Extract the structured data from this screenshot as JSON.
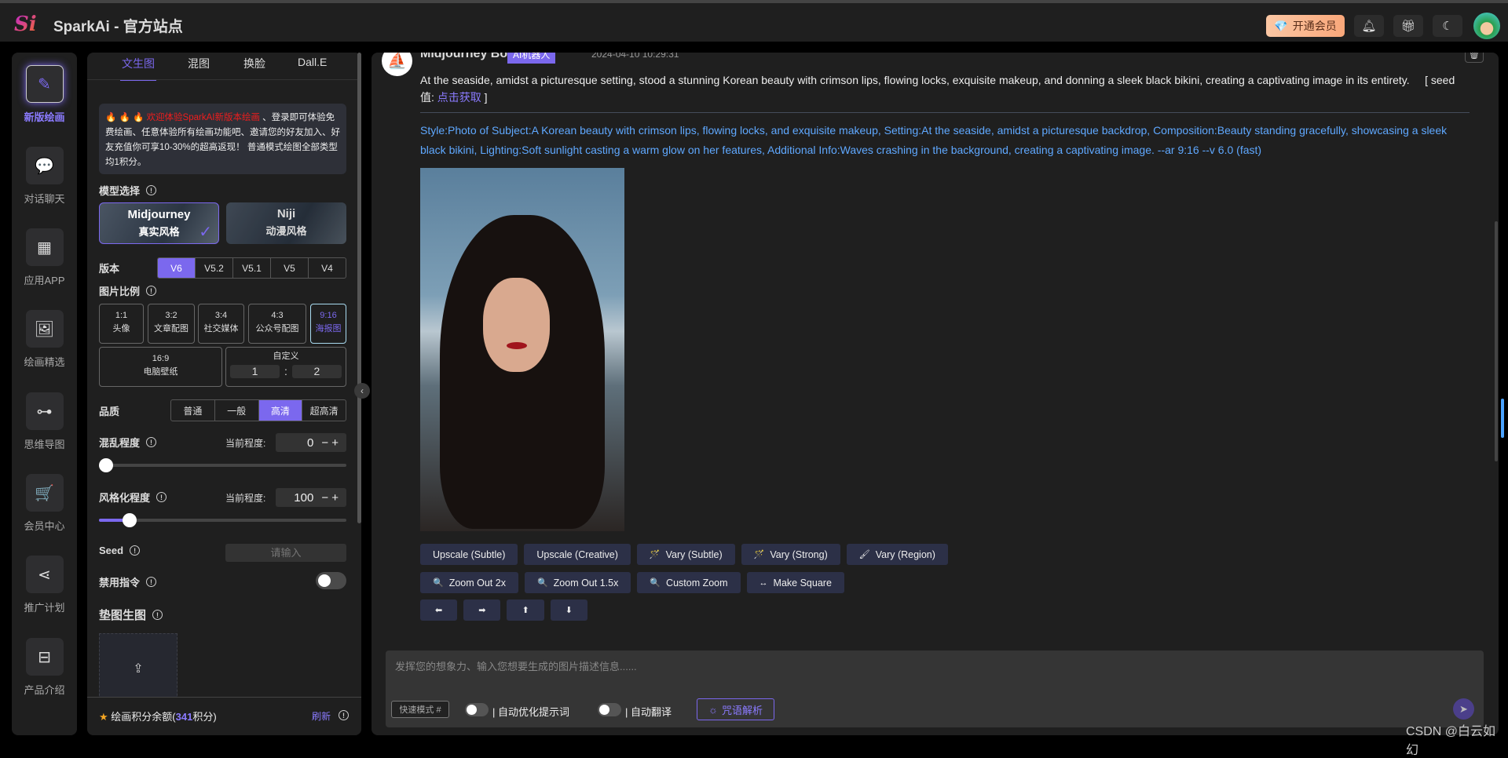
{
  "header": {
    "logo_text": "Si",
    "title": "SparkAi - 官方站点",
    "vip_label": "开通会员",
    "icons": [
      "bell-icon",
      "gift-icon",
      "moon-icon"
    ]
  },
  "nav": {
    "items": [
      {
        "label": "新版绘画",
        "icon": "✎",
        "active": true
      },
      {
        "label": "对话聊天",
        "icon": "💬"
      },
      {
        "label": "应用APP",
        "icon": "▦"
      },
      {
        "label": "绘画精选",
        "icon": "🖼"
      },
      {
        "label": "思维导图",
        "icon": "⊶"
      },
      {
        "label": "会员中心",
        "icon": "🛒"
      },
      {
        "label": "推广计划",
        "icon": "⋖"
      },
      {
        "label": "产品介绍",
        "icon": "⊟"
      }
    ]
  },
  "panel": {
    "tabs": [
      "文生图",
      "混图",
      "换脸",
      "Dall.E"
    ],
    "notice": {
      "fire": "🔥 🔥 🔥",
      "highlight": "欢迎体验SparkAI新版本绘画",
      "rest": " 、登录即可体验免费绘画、任意体验所有绘画功能吧、邀请您的好友加入、好友充值你可享10-30%的超高返现！ 普通模式绘图全部类型均1积分。"
    },
    "model_label": "模型选择",
    "models": [
      {
        "name": "Midjourney",
        "style": "真实风格"
      },
      {
        "name": "Niji",
        "style": "动漫风格"
      }
    ],
    "version_label": "版本",
    "versions": [
      "V6",
      "V5.2",
      "V5.1",
      "V5",
      "V4"
    ],
    "selected_version": "V6",
    "ratio_label": "图片比例",
    "ratios": [
      {
        "r": "1:1",
        "d": "头像"
      },
      {
        "r": "3:2",
        "d": "文章配图"
      },
      {
        "r": "3:4",
        "d": "社交媒体"
      },
      {
        "r": "4:3",
        "d": "公众号配图"
      },
      {
        "r": "9:16",
        "d": "海报图"
      }
    ],
    "ratio_wide": {
      "r": "16:9",
      "d": "电脑壁纸"
    },
    "custom": {
      "label": "自定义",
      "w": "1",
      "sep": ":",
      "h": "2"
    },
    "quality_label": "品质",
    "qualities": [
      "普通",
      "一般",
      "高清",
      "超高清"
    ],
    "selected_quality": "高清",
    "chaos": {
      "label": "混乱程度",
      "current_label": "当前程度:",
      "value": "0",
      "percent": 0
    },
    "stylize": {
      "label": "风格化程度",
      "current_label": "当前程度:",
      "value": "100",
      "percent": 10
    },
    "seed": {
      "label": "Seed",
      "placeholder": "请输入"
    },
    "no_cmd": {
      "label": "禁用指令",
      "on": false
    },
    "ref_image_label": "垫图生图",
    "footer": {
      "prefix": "绘画积分余额(",
      "points": "341",
      "suffix": "积分)",
      "refresh": "刷新"
    }
  },
  "message": {
    "bot_name": "Midjourney Bot",
    "badge": "AI机器人",
    "timestamp": "2024-04-10 10:29:31",
    "prompt": "At the seaside, amidst a picturesque setting, stood a stunning Korean beauty with crimson lips, flowing locks, exquisite makeup, and donning a sleek black bikini, creating a captivating image in its entirety.",
    "seed_prefix": "[ seed值: ",
    "seed_link": "点击获取",
    "seed_suffix": " ]",
    "description": "Style:Photo of Subject:A Korean beauty with crimson lips, flowing locks, and exquisite makeup, Setting:At the seaside, amidst a picturesque backdrop, Composition:Beauty standing gracefully, showcasing a sleek black bikini, Lighting:Soft sunlight casting a warm glow on her features, Additional Info:Waves crashing in the background, creating a captivating image. --ar 9:16 --v 6.0  (fast)",
    "row1": [
      {
        "icon": "",
        "label": "Upscale (Subtle)"
      },
      {
        "icon": "",
        "label": "Upscale (Creative)"
      },
      {
        "icon": "🪄",
        "label": "Vary (Subtle)"
      },
      {
        "icon": "🪄",
        "label": "Vary (Strong)"
      },
      {
        "icon": "🖌",
        "label": "Vary (Region)"
      }
    ],
    "row2": [
      {
        "icon": "🔍",
        "label": "Zoom Out 2x"
      },
      {
        "icon": "🔍",
        "label": "Zoom Out 1.5x"
      },
      {
        "icon": "🔍",
        "label": "Custom Zoom"
      },
      {
        "icon": "↔",
        "label": "Make Square"
      }
    ],
    "row3": [
      {
        "icon": "⬅"
      },
      {
        "icon": "➡"
      },
      {
        "icon": "⬆"
      },
      {
        "icon": "⬇"
      }
    ]
  },
  "composer": {
    "placeholder": "发挥您的想象力、输入您想要生成的图片描述信息......",
    "fast_mode": "快速模式 #",
    "auto_optimize": "自动优化提示词",
    "auto_translate": "自动翻译",
    "spell": "咒语解析"
  },
  "watermark": "CSDN @白云如幻",
  "colors": {
    "accent": "#7b68ee",
    "link": "#5fa8ff",
    "bg": "#1f1f1f"
  }
}
